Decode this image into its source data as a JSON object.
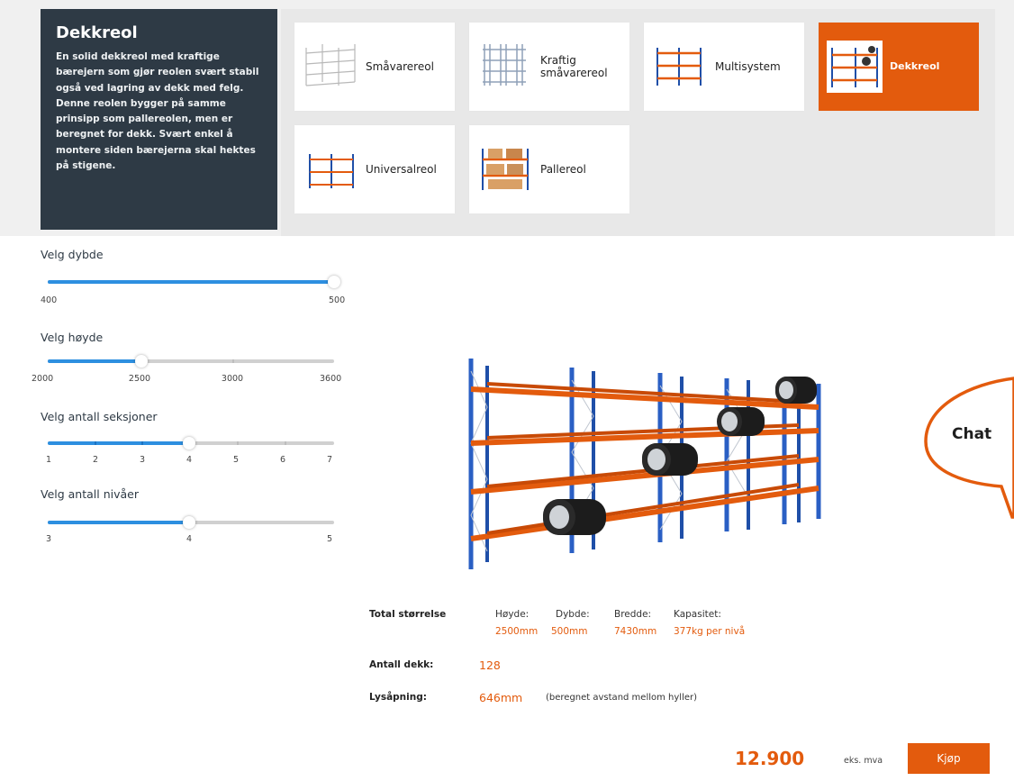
{
  "info": {
    "title": "Dekkreol",
    "description": "En solid dekkreol med kraftige bærejern som gjør reolen svært stabil også ved lagring av dekk med felg. Denne reolen bygger på samme prinsipp som pallereolen, men er beregnet for dekk. Svært enkel å montere siden bærejerna skal hektes på stigene."
  },
  "products": [
    {
      "label": "Småvarereol",
      "active": false,
      "icon": "light-shelf-icon"
    },
    {
      "label": "Kraftig småvarereol",
      "active": false,
      "icon": "heavy-shelf-icon"
    },
    {
      "label": "Multisystem",
      "active": false,
      "icon": "multisystem-icon"
    },
    {
      "label": "Dekkreol",
      "active": true,
      "icon": "tire-rack-icon"
    },
    {
      "label": "Universalreol",
      "active": false,
      "icon": "universal-rack-icon"
    },
    {
      "label": "Pallereol",
      "active": false,
      "icon": "pallet-rack-icon"
    }
  ],
  "sliders": {
    "depth": {
      "label": "Velg dybde",
      "ticks": [
        "400",
        "500"
      ],
      "value_fraction": 1.0
    },
    "height": {
      "label": "Velg høyde",
      "ticks": [
        "2000",
        "2500",
        "3000",
        "3600"
      ],
      "value_fraction": 0.333
    },
    "sections": {
      "label": "Velg antall seksjoner",
      "ticks": [
        "1",
        "2",
        "3",
        "4",
        "5",
        "6",
        "7"
      ],
      "value_fraction": 0.5
    },
    "levels": {
      "label": "Velg antall nivåer",
      "ticks": [
        "3",
        "4",
        "5"
      ],
      "value_fraction": 0.5
    }
  },
  "specs": {
    "total_label": "Total størrelse",
    "height_label": "Høyde:",
    "height_value": "2500mm",
    "depth_label": "Dybde:",
    "depth_value": "500mm",
    "width_label": "Bredde:",
    "width_value": "7430mm",
    "capacity_label": "Kapasitet:",
    "capacity_value": "377kg per nivå",
    "tires_label": "Antall dekk:",
    "tires_value": "128",
    "opening_label": "Lysåpning:",
    "opening_value": "646mm",
    "opening_note": "(beregnet avstand mellom hyller)"
  },
  "price": {
    "amount": "12.900",
    "suffix": "eks. mva"
  },
  "buy_label": "Kjøp",
  "chat_label": "Chat",
  "colors": {
    "accent": "#e35b0d",
    "dark": "#2e3a45",
    "slider": "#2d8fe0",
    "rack_blue": "#1f4fa8"
  }
}
